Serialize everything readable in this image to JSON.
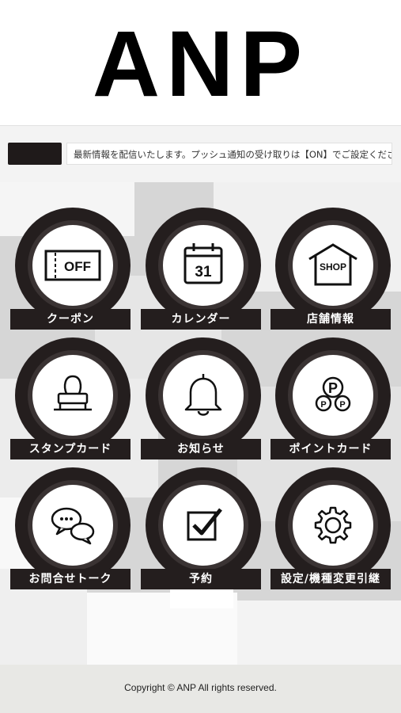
{
  "header": {
    "logo_text": "ANP"
  },
  "ticker": {
    "text": "最新情報を配信いたします。プッシュ通知の受け取りは【ON】でご設定ください。"
  },
  "menu": {
    "items": [
      {
        "label": "クーポン",
        "icon": "coupon-off-icon",
        "icon_text": "OFF"
      },
      {
        "label": "カレンダー",
        "icon": "calendar-icon",
        "icon_text": "31"
      },
      {
        "label": "店舗情報",
        "icon": "shop-icon",
        "icon_text": "SHOP"
      },
      {
        "label": "スタンプカード",
        "icon": "stamp-icon"
      },
      {
        "label": "お知らせ",
        "icon": "bell-icon"
      },
      {
        "label": "ポイントカード",
        "icon": "point-coins-icon",
        "icon_text": "P"
      },
      {
        "label": "お問合せトーク",
        "icon": "chat-bubbles-icon"
      },
      {
        "label": "予約",
        "icon": "checkbox-icon"
      },
      {
        "label": "設定/機種変更引継",
        "icon": "gear-icon"
      }
    ]
  },
  "footer": {
    "copyright": "Copyright © ANP All rights reserved."
  },
  "colors": {
    "dark": "#241e1e",
    "background": "#dcdcdc",
    "white": "#ffffff"
  }
}
